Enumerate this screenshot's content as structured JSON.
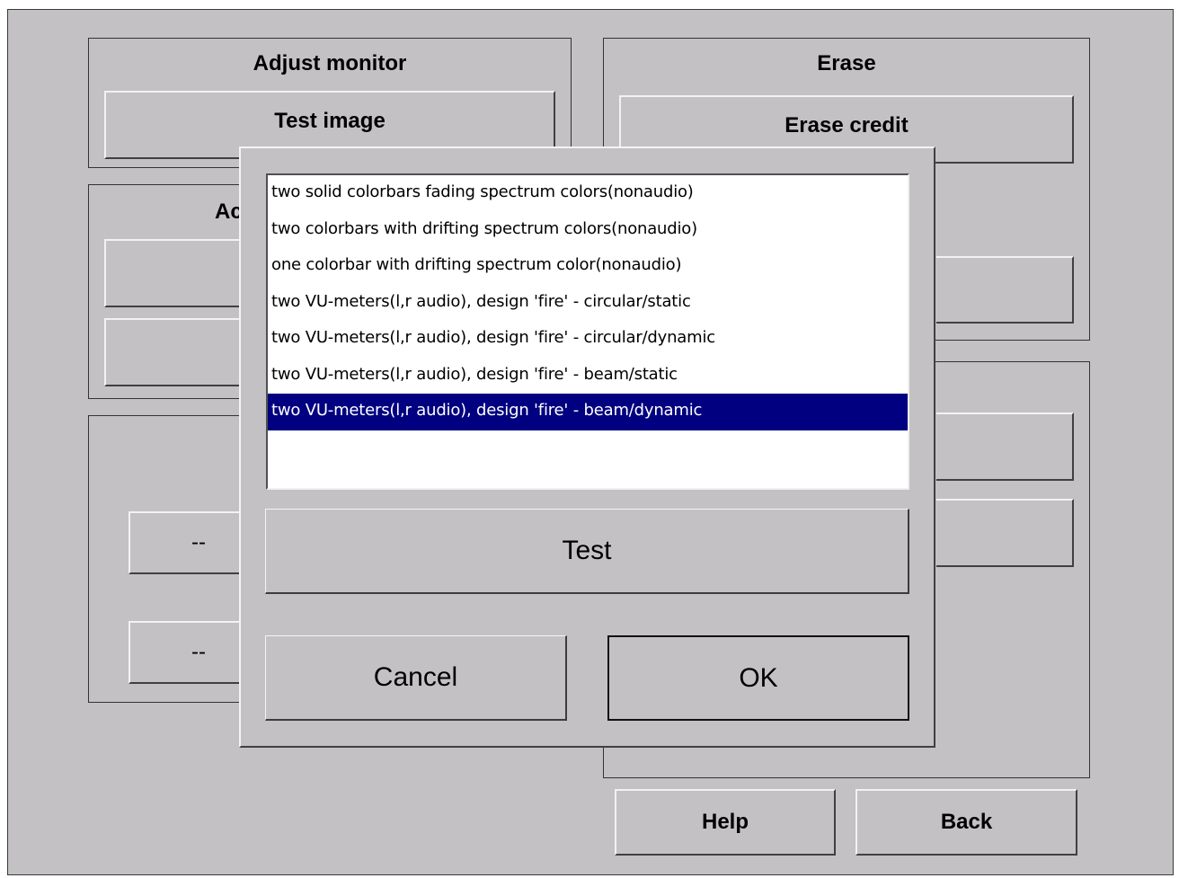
{
  "background": {
    "adjust_monitor": {
      "title": "Adjust monitor",
      "test_image_button": "Test image"
    },
    "erase": {
      "title": "Erase",
      "erase_credit_button": "Erase credit"
    },
    "partial_panel_title": "Ac",
    "dash_button_1": "--",
    "dash_button_2": "--",
    "help_button": "Help",
    "back_button": "Back"
  },
  "dialog": {
    "list_items": [
      "two solid colorbars fading spectrum colors(nonaudio)",
      "two colorbars with drifting spectrum colors(nonaudio)",
      "one colorbar with drifting spectrum color(nonaudio)",
      "two VU-meters(l,r audio), design 'fire' - circular/static",
      "two VU-meters(l,r audio), design 'fire' - circular/dynamic",
      "two VU-meters(l,r audio), design 'fire' - beam/static",
      "two VU-meters(l,r audio), design 'fire' - beam/dynamic"
    ],
    "selected_index": 6,
    "test_button": "Test",
    "cancel_button": "Cancel",
    "ok_button": "OK"
  },
  "colors": {
    "background": "#c3c1c4",
    "selection": "#000080"
  }
}
